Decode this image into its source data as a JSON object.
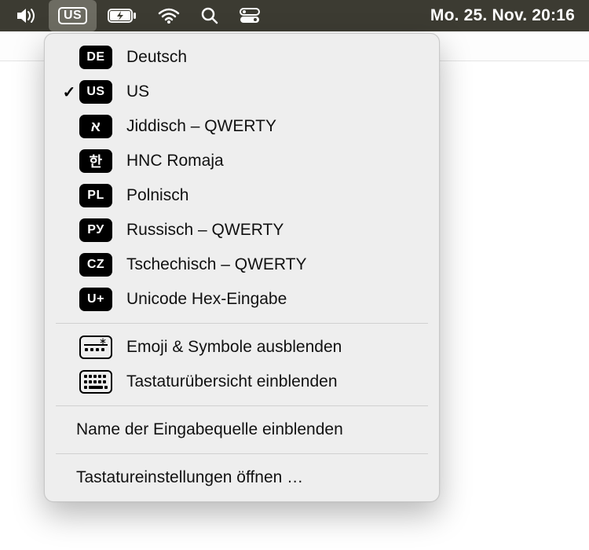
{
  "menubar": {
    "active_input_badge": "US",
    "clock": "Mo. 25. Nov.  20:16"
  },
  "dropdown": {
    "inputs": [
      {
        "code": "DE",
        "label": "Deutsch",
        "selected": false
      },
      {
        "code": "US",
        "label": "US",
        "selected": true
      },
      {
        "code": "א",
        "label": "Jiddisch – QWERTY",
        "selected": false,
        "glyph": true
      },
      {
        "code": "한",
        "label": "HNC Romaja",
        "selected": false,
        "glyph": true
      },
      {
        "code": "PL",
        "label": "Polnisch",
        "selected": false
      },
      {
        "code": "РУ",
        "label": "Russisch – QWERTY",
        "selected": false
      },
      {
        "code": "CZ",
        "label": "Tschechisch – QWERTY",
        "selected": false
      },
      {
        "code": "U+",
        "label": "Unicode Hex-Eingabe",
        "selected": false
      }
    ],
    "emoji_toggle": "Emoji & Symbole ausblenden",
    "keyboard_viewer": "Tastaturübersicht einblenden",
    "show_input_name": "Name der Eingabequelle einblenden",
    "open_settings": "Tastatureinstellungen öffnen …"
  }
}
